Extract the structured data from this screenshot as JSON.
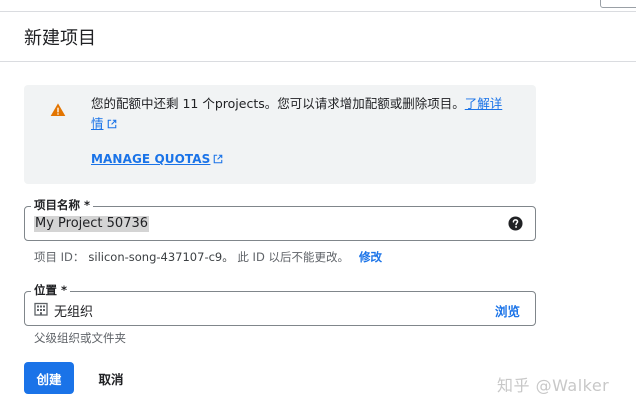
{
  "header": {
    "title": "新建项目"
  },
  "quota": {
    "message": "您的配额中还剩 11 个projects。您可以请求增加配额或删除项目。",
    "learn_more_1": "了解详",
    "learn_more_2": "情",
    "manage_label": "MANAGE QUOTAS"
  },
  "project_name": {
    "label": "项目名称 *",
    "value": "My Project 50736"
  },
  "project_id": {
    "prefix": "项目 ID：",
    "value": "silicon-song-437107-c9。",
    "suffix": "此 ID 以后不能更改。",
    "edit_label": "修改"
  },
  "location": {
    "label": "位置 *",
    "value": "无组织",
    "browse_label": "浏览",
    "hint": "父级组织或文件夹"
  },
  "actions": {
    "create_label": "创建",
    "cancel_label": "取消"
  },
  "watermark": {
    "text": "知乎 @Walker"
  },
  "colors": {
    "accent": "#1a73e8",
    "warning": "#e37400",
    "notice_bg": "#f1f3f4"
  }
}
